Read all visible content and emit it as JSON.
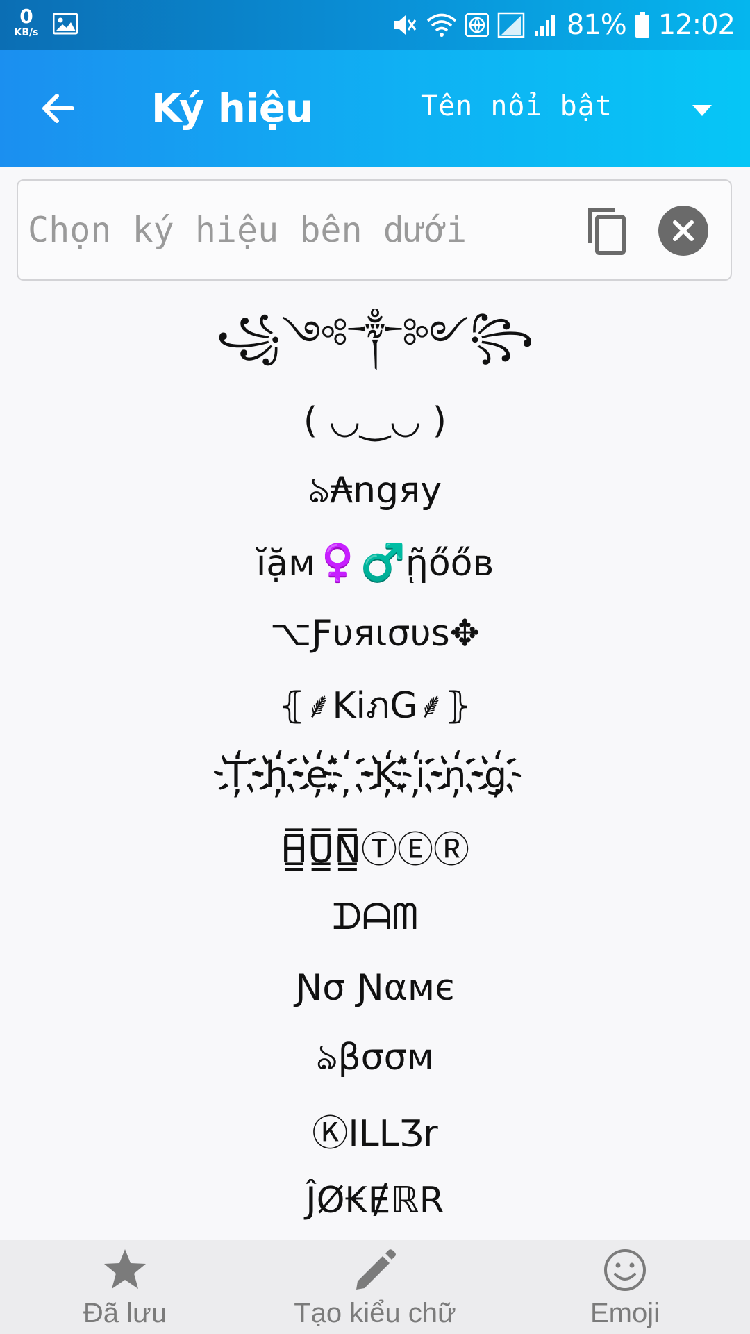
{
  "status_bar": {
    "net_speed": "0",
    "net_unit": "KB/s",
    "battery": "81%",
    "time": "12:02"
  },
  "app_bar": {
    "title": "Ký hiệu",
    "dropdown_value": "Tên nổi bật"
  },
  "input": {
    "placeholder": "Chọn ký hiệu bên dưới",
    "value": ""
  },
  "symbols": [
    "꧁༺༒༻꧂",
    "( ◡‿◡ )",
    "ঌ₳ngяy",
    "ĭặм♀️♂️ῇőőв",
    "⌥Ƒυяισυs✥",
    "⦃⸙KiภG⸙⦄",
    "T҉h҉e҉ ҉K҉i҉n҉g҉",
    "H̳̿U̳̿N̳̿ⓉⒺⓇ",
    "ᗪᗩᗰ",
    "Ɲσ Ɲαмє",
    "ঌβσσм",
    "ⓀILLƷr",
    "ĴØ₭ɆℝR"
  ],
  "bottom_nav": {
    "saved": "Đã lưu",
    "create_style": "Tạo kiểu chữ",
    "emoji": "Emoji"
  }
}
